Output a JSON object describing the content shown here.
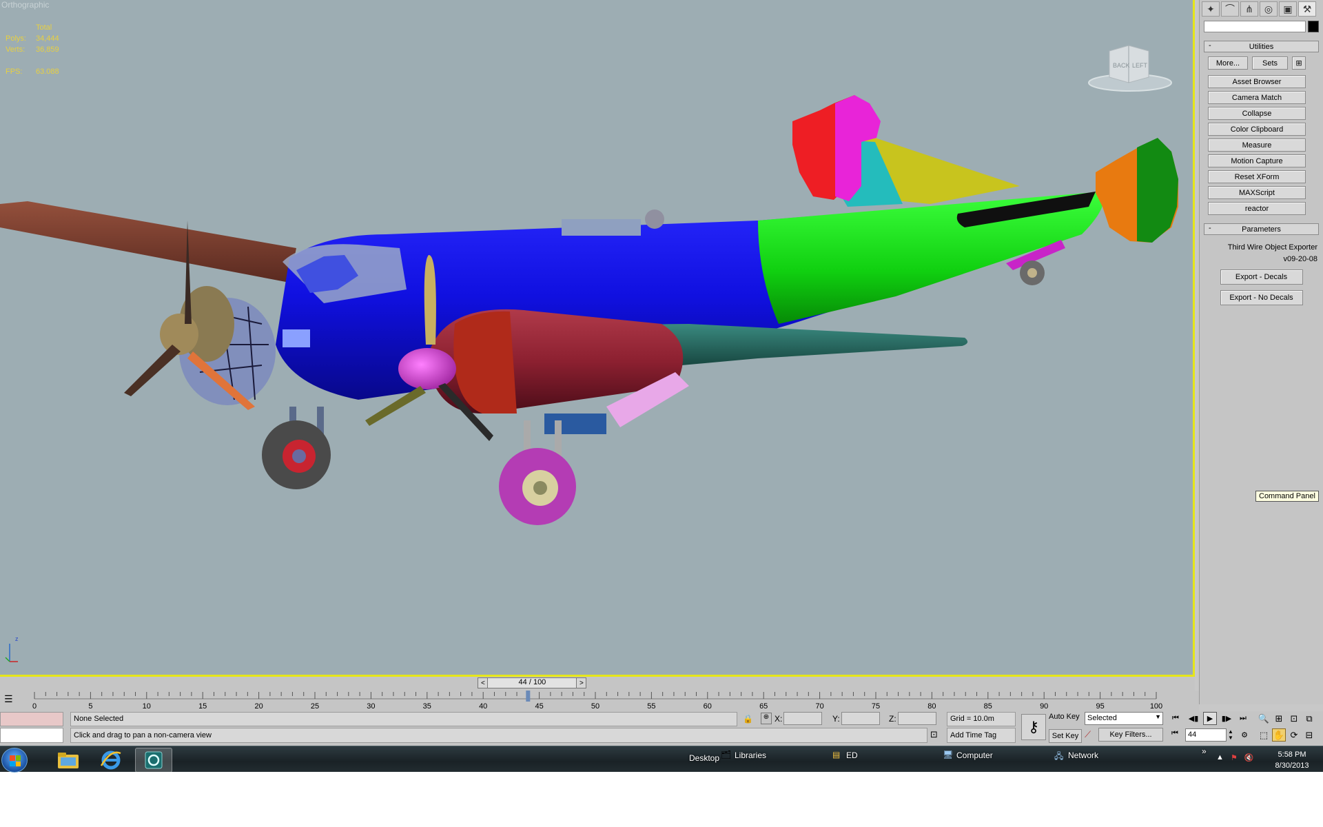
{
  "viewport": {
    "label": "Orthographic",
    "stats": {
      "total_label": "Total",
      "polys_label": "Polys:",
      "polys_value": "34,444",
      "verts_label": "Verts:",
      "verts_value": "36,859",
      "fps_label": "FPS:",
      "fps_value": "63.088"
    },
    "viewcube": {
      "face1": "BACK",
      "face2": "LEFT"
    },
    "axis_label": "z"
  },
  "command_panel": {
    "tabs": [
      "create-icon",
      "modify-icon",
      "hierarchy-icon",
      "motion-icon",
      "display-icon",
      "utilities-icon"
    ],
    "object_name": "",
    "object_color": "#000000",
    "utilities_rollout": {
      "title": "Utilities",
      "more_label": "More...",
      "sets_label": "Sets",
      "buttons": [
        "Asset Browser",
        "Camera Match",
        "Collapse",
        "Color Clipboard",
        "Measure",
        "Motion Capture",
        "Reset XForm",
        "MAXScript",
        "reactor"
      ]
    },
    "parameters_rollout": {
      "title": "Parameters",
      "exporter_name": "Third Wire Object Exporter",
      "exporter_version": "v09-20-08",
      "export_decals": "Export - Decals",
      "export_no_decals": "Export - No Decals"
    },
    "tooltip": "Command Panel"
  },
  "time_slider": {
    "text": "44 / 100",
    "prev": "<",
    "next": ">",
    "current": 44,
    "total": 100
  },
  "trackbar": {
    "ticks": [
      0,
      5,
      10,
      15,
      20,
      25,
      30,
      35,
      40,
      45,
      50,
      55,
      60,
      65,
      70,
      75,
      80,
      85,
      90,
      95,
      100
    ]
  },
  "status": {
    "selection": "None Selected",
    "prompt": "Click and drag to pan a non-camera view",
    "x_label": "X:",
    "y_label": "Y:",
    "z_label": "Z:",
    "grid": "Grid = 10.0m",
    "add_time_tag": "Add Time Tag",
    "auto_key": "Auto Key",
    "set_key": "Set Key",
    "selected_dropdown": "Selected",
    "key_filters": "Key Filters...",
    "frame_value": "44"
  },
  "taskbar": {
    "desktop_label": "Desktop",
    "links": [
      "Libraries",
      "ED",
      "Computer",
      "Network"
    ],
    "time": "5:58 PM",
    "date": "8/30/2013",
    "tray_chevron": "»"
  },
  "colors": {
    "viewport_bg": "#9dadb3",
    "active_border": "#e6e619",
    "stats_text": "#e8d040",
    "fuselage_front": "#1414e6",
    "fuselage_rear": "#1ee61e",
    "nacelle": "#8c2030",
    "wing": "#1e6e64",
    "far_wing": "#7a3a2a"
  }
}
